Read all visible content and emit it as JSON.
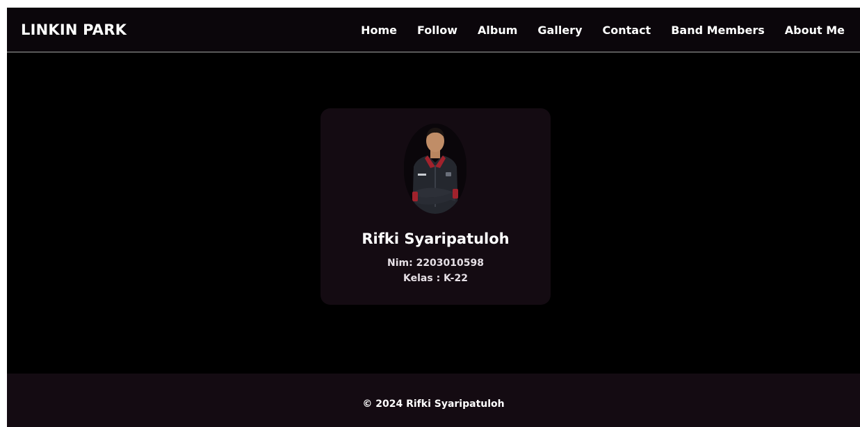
{
  "navbar": {
    "brand": "LINKIN PARK",
    "links": [
      {
        "label": "Home"
      },
      {
        "label": "Follow"
      },
      {
        "label": "Album"
      },
      {
        "label": "Gallery"
      },
      {
        "label": "Contact"
      },
      {
        "label": "Band Members"
      },
      {
        "label": "About Me"
      }
    ]
  },
  "profile": {
    "name": "Rifki Syaripatuloh",
    "nim": "Nim: 2203010598",
    "kelas": "Kelas : K-22"
  },
  "footer": {
    "copyright": "© 2024 Rifki Syaripatuloh"
  },
  "colors": {
    "background": "#000000",
    "navbar": "#0b060b",
    "card": "#140b12",
    "footer": "#140b12",
    "text": "#ffffff",
    "jacket": "#24272e",
    "jacket_accent": "#a1222c"
  }
}
